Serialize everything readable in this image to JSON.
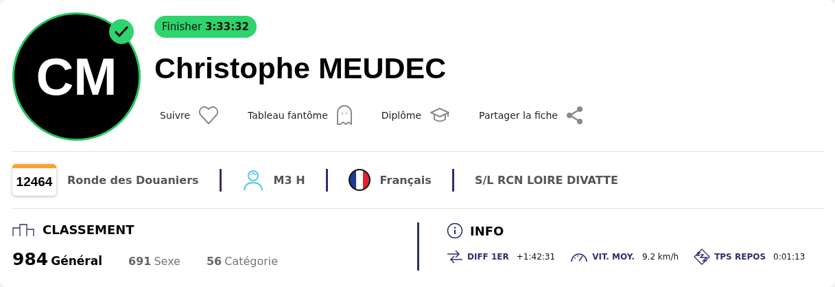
{
  "avatar": {
    "initials": "CM",
    "verified": true
  },
  "badge": "Finisher **3:33:32**",
  "name": "Christophe MEUDEC",
  "actions": [
    {
      "label": "Suivre",
      "kind": "heart"
    },
    {
      "label": "Tableau fantôme",
      "kind": "ghost"
    },
    {
      "label": "Diplôme",
      "kind": "cap"
    },
    {
      "label": "Partager la fiche",
      "kind": "share"
    }
  ],
  "bib": "12464",
  "details": [
    {
      "kind": "race",
      "text": "Ronde des Douaniers"
    },
    {
      "kind": "category",
      "text": "M3 H"
    },
    {
      "kind": "flag",
      "text": "Français"
    },
    {
      "kind": "club",
      "text": "S/L RCN LOIRE DIVATTE"
    }
  ],
  "ranking": {
    "title": "CLASSEMENT",
    "items": [
      {
        "value": "984",
        "label": "Général",
        "primary": true
      },
      {
        "value": "691",
        "label": "Sexe",
        "primary": false
      },
      {
        "value": "56",
        "label": "Catégorie",
        "primary": false
      }
    ]
  },
  "info": {
    "title": "INFO",
    "items": [
      {
        "kind": "diff",
        "label": "DIFF 1ER",
        "value": "+1:42:31"
      },
      {
        "kind": "speed",
        "label": "VIT. MOY.",
        "value": "9.2 km/h"
      },
      {
        "kind": "rest",
        "label": "TPS REPOS",
        "value": "0:01:13"
      }
    ]
  }
}
